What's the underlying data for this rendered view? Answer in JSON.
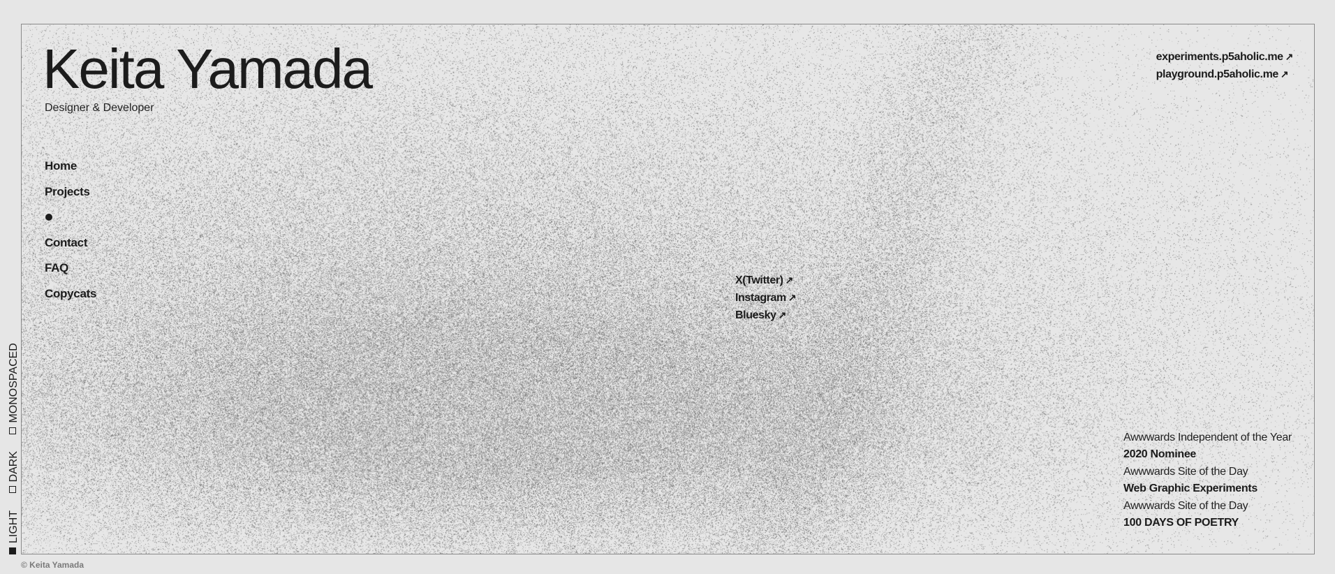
{
  "header": {
    "title": "Keita Yamada",
    "subtitle": "Designer & Developer"
  },
  "nav": {
    "items": [
      {
        "label": "Home"
      },
      {
        "label": "Projects"
      },
      {
        "label": "Contact"
      },
      {
        "label": "FAQ"
      },
      {
        "label": "Copycats"
      }
    ],
    "active_marker": "filled-circle-icon"
  },
  "external_links": [
    {
      "label": "experiments.p5aholic.me",
      "icon": "arrow-up-right-icon"
    },
    {
      "label": "playground.p5aholic.me",
      "icon": "arrow-up-right-icon"
    }
  ],
  "social_links": [
    {
      "label": "X(Twitter)",
      "icon": "arrow-up-right-icon"
    },
    {
      "label": "Instagram",
      "icon": "arrow-up-right-icon"
    },
    {
      "label": "Bluesky",
      "icon": "arrow-up-right-icon"
    }
  ],
  "awards": [
    {
      "org": "Awwwards Independent of the Year",
      "name": "2020 Nominee"
    },
    {
      "org": "Awwwards Site of the Day",
      "name": "Web Graphic Experiments"
    },
    {
      "org": "Awwwards Site of the Day",
      "name": "100 DAYS OF POETRY"
    }
  ],
  "theme_switch": {
    "options": [
      {
        "label": "LIGHT",
        "selected": true
      },
      {
        "label": "DARK",
        "selected": false
      },
      {
        "label": "MONOSPACED",
        "selected": false
      }
    ]
  },
  "footer": {
    "copyright": "© Keita Yamada"
  },
  "colors": {
    "background": "#e6e6e6",
    "text": "#1c1c1c",
    "frame_border": "#8a8a8a",
    "muted": "#7a7a7a"
  }
}
